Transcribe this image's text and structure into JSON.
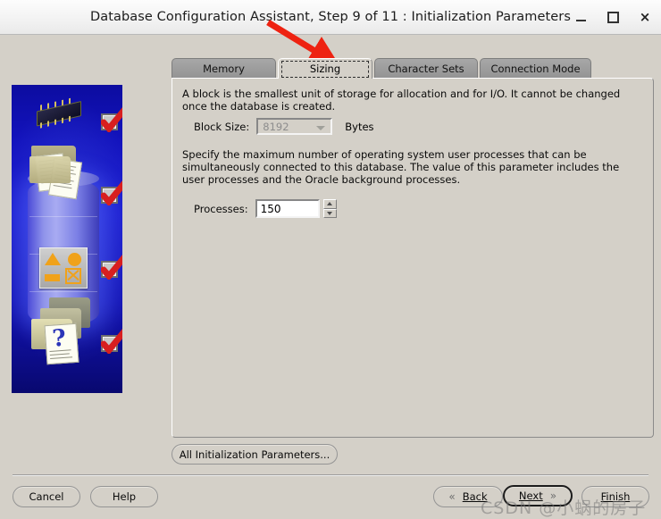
{
  "window": {
    "title": "Database Configuration Assistant, Step 9 of 11 : Initialization Parameters",
    "controls": {
      "minimize": "_",
      "maximize": "□",
      "close": "×"
    }
  },
  "tabs": [
    {
      "label": "Memory",
      "active": false
    },
    {
      "label": "Sizing",
      "active": true
    },
    {
      "label": "Character Sets",
      "active": false
    },
    {
      "label": "Connection Mode",
      "active": false
    }
  ],
  "panel": {
    "block_paragraph": "A block is the smallest unit of storage for allocation and for I/O. It cannot be changed once the database is created.",
    "block_size_label": "Block Size:",
    "block_size_value": "8192",
    "block_size_unit": "Bytes",
    "processes_paragraph": "Specify the maximum number of operating system user processes that can be simultaneously connected to this database. The value of this parameter includes the user processes and the Oracle background processes.",
    "processes_label": "Processes:",
    "processes_value": "150"
  },
  "buttons": {
    "all_parameters": "All Initialization Parameters...",
    "cancel": "Cancel",
    "help": "Help",
    "back": "Back",
    "back_chevron": "«",
    "next": "Next",
    "next_chevron": "»",
    "finish": "Finish"
  },
  "annotation": {
    "arrow_color": "#ee2211",
    "target": "sizing-tab"
  },
  "watermark": "CSDN @小蜗的房子",
  "sidebar": {
    "alt": "Oracle database configuration illustration",
    "checkmarks": 4,
    "checkmark_color": "#d81f1f",
    "background_color": "#1414c8"
  }
}
